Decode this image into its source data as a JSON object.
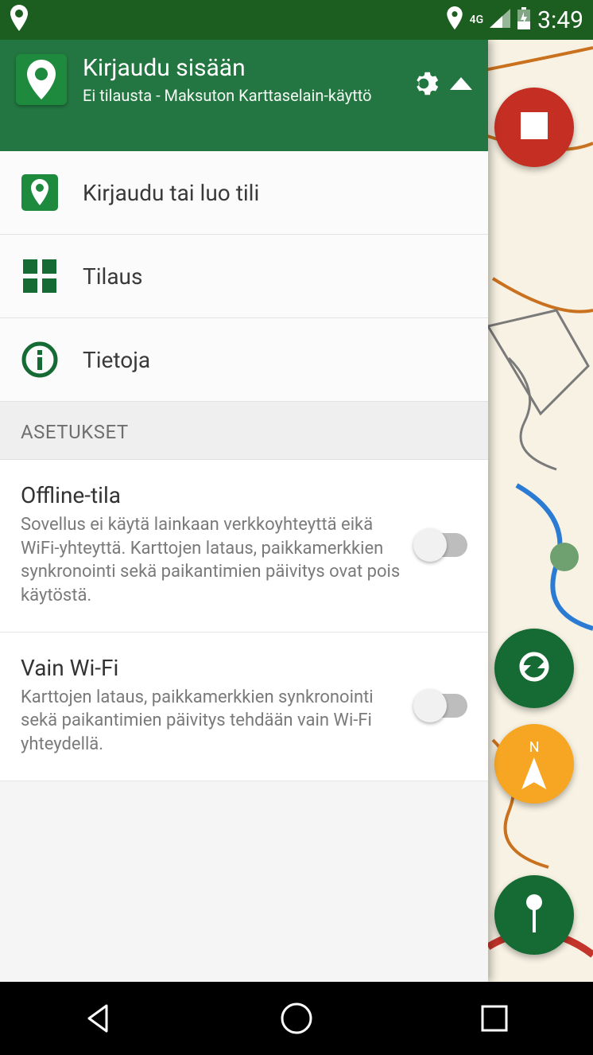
{
  "status_bar": {
    "network": "4G",
    "time": "3:49"
  },
  "drawer": {
    "header": {
      "title": "Kirjaudu sisään",
      "subtitle": "Ei tilausta - Maksuton Karttaselain-käyttö"
    },
    "menu": [
      {
        "icon": "app-pin-icon",
        "label": "Kirjaudu tai luo tili"
      },
      {
        "icon": "grid-icon",
        "label": "Tilaus"
      },
      {
        "icon": "info-icon",
        "label": "Tietoja"
      }
    ],
    "section_header": "ASETUKSET",
    "settings": [
      {
        "title": "Offline-tila",
        "desc": "Sovellus ei käytä lainkaan verkkoyhteyttä eikä WiFi-yhteyttä. Karttojen lataus, paikkamerkkien synkronointi sekä paikantimien päivitys ovat pois käytöstä.",
        "on": false
      },
      {
        "title": "Vain Wi-Fi",
        "desc": "Karttojen lataus, paikkamerkkien synkronointi sekä paikantimien päivitys tehdään vain Wi-Fi yhteydellä.",
        "on": false
      }
    ]
  },
  "fabs": {
    "compass_label": "N"
  },
  "colors": {
    "primary": "#237641",
    "primary_dark": "#1b5e20",
    "accent": "#1e8a3e"
  }
}
